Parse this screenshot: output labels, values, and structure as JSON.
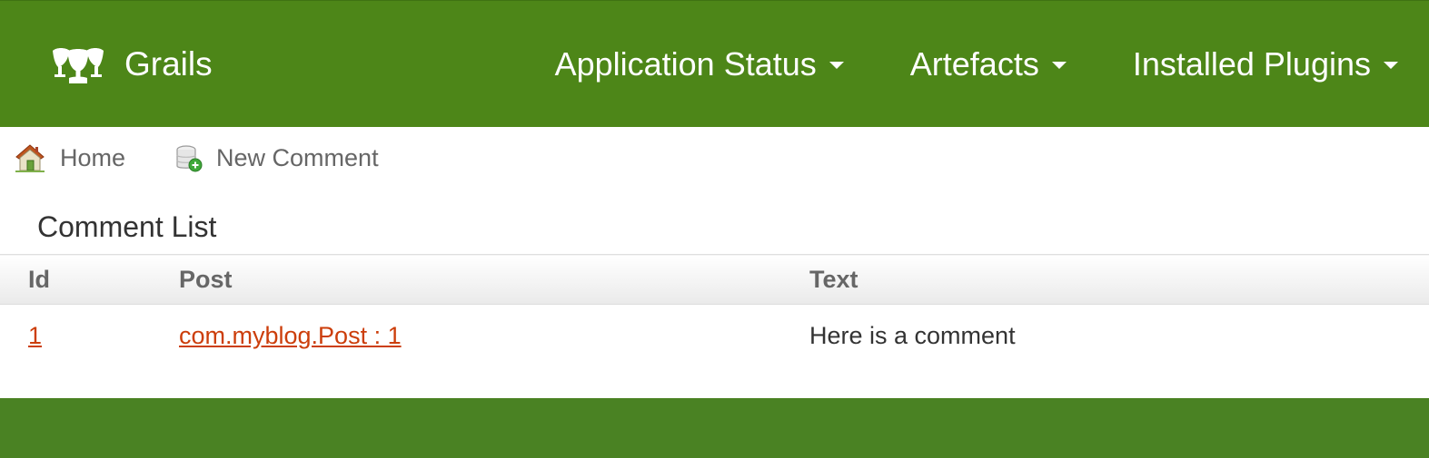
{
  "navbar": {
    "brand": "Grails",
    "menu": [
      {
        "label": "Application Status"
      },
      {
        "label": "Artefacts"
      },
      {
        "label": "Installed Plugins"
      }
    ]
  },
  "subnav": {
    "home": "Home",
    "new_comment": "New Comment"
  },
  "page": {
    "title": "Comment List"
  },
  "table": {
    "headers": [
      "Id",
      "Post",
      "Text"
    ],
    "rows": [
      {
        "id": "1",
        "post": "com.myblog.Post : 1",
        "text": "Here is a comment"
      }
    ]
  },
  "colors": {
    "navbar": "#4d8618",
    "footer": "#4a8223",
    "link": "#cc3e0b"
  },
  "icons": {
    "brand": "grails-chalice-icon",
    "home": "house-icon",
    "new": "database-add-icon",
    "dropdown": "caret-down-icon"
  }
}
